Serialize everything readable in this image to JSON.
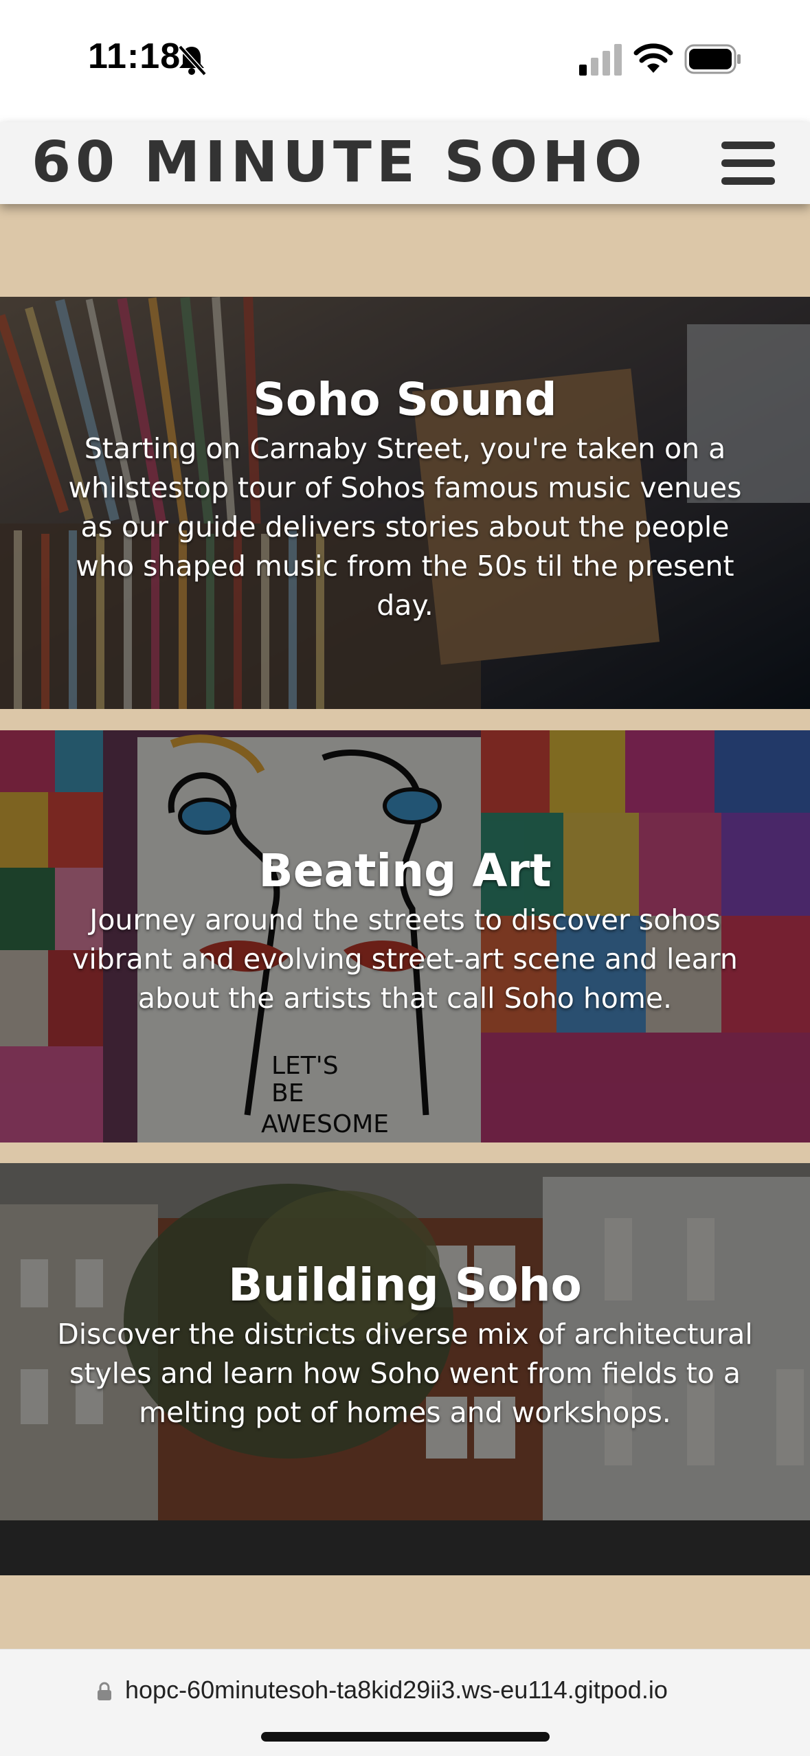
{
  "status_bar": {
    "time": "11:18",
    "icons": [
      "bell-slash-icon",
      "cellular-signal-icon",
      "wifi-icon",
      "battery-icon"
    ]
  },
  "header": {
    "title": "60 MINUTE SOHO",
    "menu_icon": "hamburger-menu-icon",
    "background": "#f3f3f3",
    "text_color": "#333333"
  },
  "page": {
    "background": "#dcc7a8"
  },
  "tours": [
    {
      "title": "Soho Sound",
      "description": "Starting on Carnaby Street, you're taken on a whilstestop tour of Sohos famous music venues as our guide delivers stories about the people who shaped music from the 50s til the present day.",
      "image": "record-crates-photo"
    },
    {
      "title": "Beating Art",
      "description": "Journey around the streets to discover sohos vibrant and evolving street-art scene and learn about the artists that call Soho home.",
      "image": "street-art-mural-photo",
      "mural_text": [
        "LET'S",
        "BE",
        "AWESOME"
      ]
    },
    {
      "title": "Building Soho",
      "description": "Discover the districts diverse mix of architectural styles and learn how Soho went from fields to a melting pot of homes and workshops.",
      "image": "brick-houses-photo"
    }
  ],
  "browser": {
    "url": "hopc-60minutesoh-ta8kid29ii3.ws-eu114.gitpod.io",
    "lock_icon": "lock-icon"
  }
}
